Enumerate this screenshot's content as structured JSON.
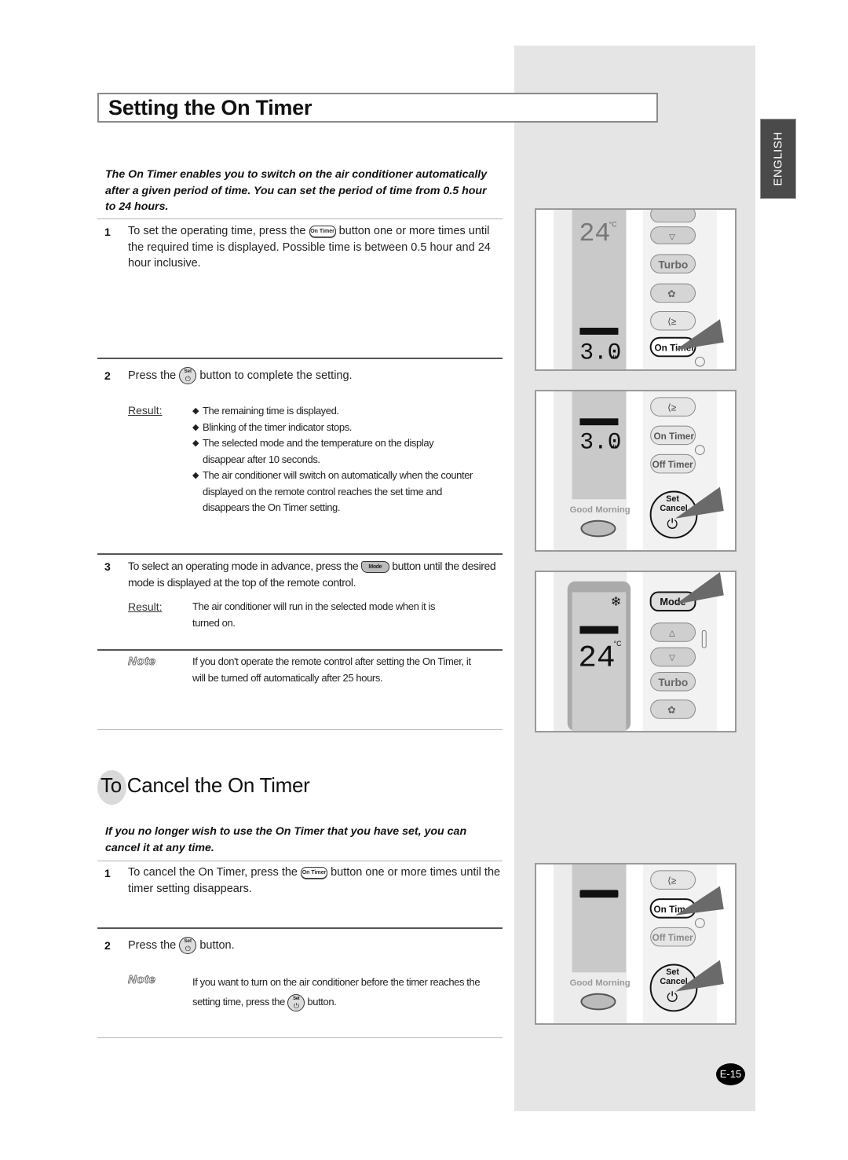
{
  "page": {
    "language_tab": "ENGLISH",
    "page_number": "E-15"
  },
  "section1": {
    "title": "Setting the On Timer",
    "intro": "The On Timer enables you to switch on the air conditioner automatically after a given period of time. You can set the period of time from 0.5 hour to 24 hours.",
    "steps": [
      {
        "number": "1",
        "text_before": "To set the operating time, press the",
        "icon": "on-timer-button",
        "text_after": "button one or more times until the required time is displayed. Possible time is between 0.5 hour and 24 hour inclusive."
      },
      {
        "number": "2",
        "text_before": "Press the",
        "icon": "set-cancel-button",
        "text_after": "button to complete the setting.",
        "result_label": "Result:",
        "results": [
          "The remaining time is displayed.",
          "Blinking of the timer indicator stops.",
          "The selected mode and the temperature on the display disappear after 10 seconds.",
          "The air conditioner will switch on automatically when the counter displayed on the remote control reaches the set time and disappears the On Timer setting."
        ]
      },
      {
        "number": "3",
        "text_before": "To select an operating mode in advance, press the",
        "icon": "mode-button",
        "text_after": "button until the desired mode is displayed at the top of the remote control.",
        "result_label": "Result:",
        "result_text": "The air conditioner will run in the selected mode when it is turned on."
      }
    ],
    "note_label": "Note",
    "note_text": "If you don't operate the remote control after setting the On Timer, it will be turned off automatically after 25 hours."
  },
  "section2": {
    "title": "To Cancel the On Timer",
    "intro": "If you no longer wish to use the On Timer that you have set, you can cancel it at any time.",
    "steps": [
      {
        "number": "1",
        "text_before": "To cancel the On Timer, press the",
        "icon": "on-timer-button",
        "text_after": "button one or more times until the timer setting disappears."
      },
      {
        "number": "2",
        "text_before": "Press the",
        "icon": "set-cancel-button",
        "text_after": "button."
      }
    ],
    "note_label": "Note",
    "note_text_before": "If you want to turn on the air conditioner before the timer reaches the setting time, press the",
    "note_icon": "set-cancel-button",
    "note_text_after": "button."
  },
  "icons": {
    "on_timer": "On Timer",
    "mode": "Mode",
    "set": "Set",
    "cancel": "Cancel",
    "power": "⏻"
  },
  "illustrations": [
    {
      "display_temp": "24",
      "temp_unit": "°C",
      "display_time": "3.0",
      "time_unit": "Hr.",
      "buttons": [
        "△",
        "▽",
        "Turbo",
        "fan",
        "swing",
        "On Timer"
      ],
      "highlighted": "On Timer"
    },
    {
      "display_time": "3.0",
      "time_unit": "Hr.",
      "good_morning": "Good Morning",
      "buttons": [
        "swing",
        "On Timer",
        "Off Timer",
        "Set Cancel"
      ],
      "highlighted": "Set Cancel"
    },
    {
      "mode_symbol": "❄",
      "display_temp": "24",
      "temp_unit": "°C",
      "buttons": [
        "Mode",
        "△",
        "▽",
        "Turbo",
        "fan"
      ],
      "highlighted": "Mode"
    },
    {
      "good_morning": "Good Morning",
      "buttons": [
        "swing",
        "On Timer",
        "Off Timer",
        "Set Cancel"
      ],
      "highlighted": [
        "On Timer",
        "Set Cancel"
      ]
    }
  ],
  "colors": {
    "sidebar_gray": "#e5e5e5",
    "tab_dark": "#4a4a4a",
    "rule_dark": "#555555",
    "rule_light": "#b5b5b5"
  }
}
